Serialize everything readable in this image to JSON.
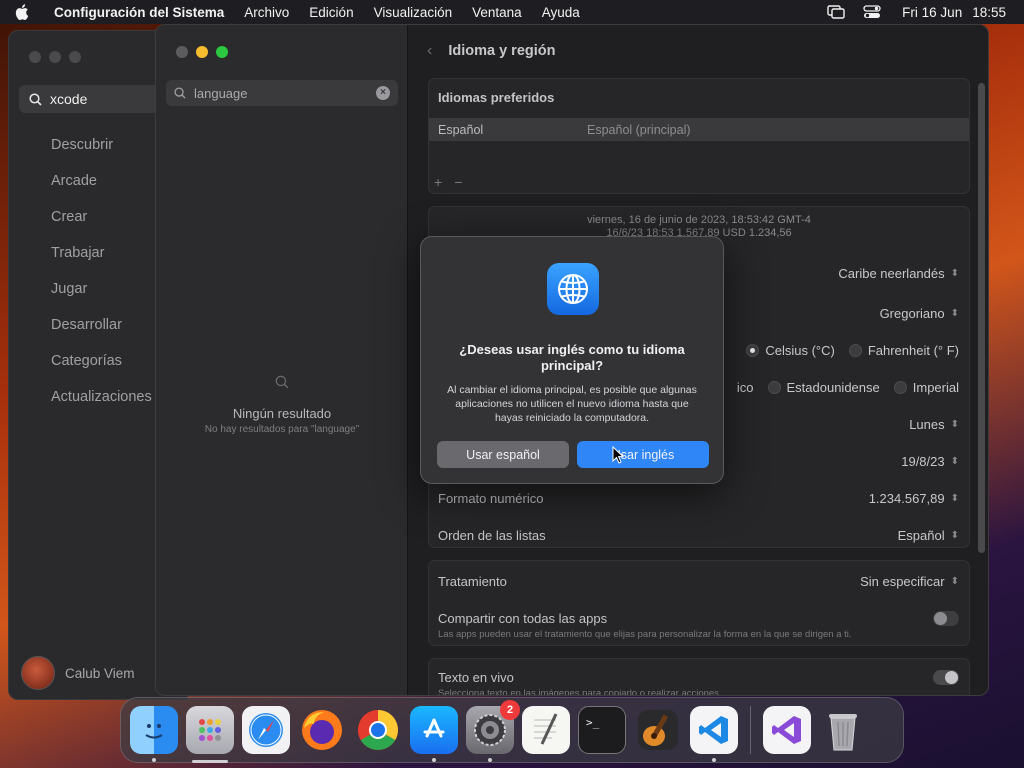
{
  "menubar": {
    "app_name": "Configuración del Sistema",
    "items": [
      "Archivo",
      "Edición",
      "Visualización",
      "Ventana",
      "Ayuda"
    ],
    "date": "Fri 16 Jun",
    "time": "18:55",
    "icons": [
      "apple-icon",
      "screen-mirroring-icon",
      "control-center-icon"
    ]
  },
  "appstore": {
    "search_value": "xcode",
    "nav": [
      "Descubrir",
      "Arcade",
      "Crear",
      "Trabajar",
      "Jugar",
      "Desarrollar",
      "Categorías",
      "Actualizaciones"
    ],
    "user_name": "Calub Viem"
  },
  "settings": {
    "search_value": "language",
    "empty_title": "Ningún resultado",
    "empty_subtitle": "No hay resultados para \"language\"",
    "page_title": "Idioma y región",
    "preferred": {
      "title": "Idiomas preferidos",
      "language": "Español",
      "language_note": "Español (principal)",
      "add": "+",
      "remove": "−"
    },
    "preview": {
      "line1": "viernes, 16 de junio de 2023, 18:53:42 GMT-4",
      "line2": "16/6/23 18:53       1.567,89       USD 1.234,56"
    },
    "rows": {
      "region": "Caribe neerlandés",
      "calendar": "Gregoriano",
      "temp_c": "Celsius (°C)",
      "temp_f": "Fahrenheit (° F)",
      "measure_partial": "ico",
      "measure_us": "Estadounidense",
      "measure_imperial": "Imperial",
      "first_day": "Lunes",
      "date_format": "19/8/23",
      "number_format_label": "Formato numérico",
      "number_format": "1.234.567,89",
      "list_order_label": "Orden de las listas",
      "list_order": "Español"
    },
    "address": {
      "label": "Tratamiento",
      "value": "Sin especificar",
      "share_label": "Compartir con todas las apps",
      "share_desc": "Las apps pueden usar el tratamiento que elijas para personalizar la forma en la que se dirigen a ti."
    },
    "live_text": {
      "label": "Texto en vivo",
      "desc": "Selecciona texto en las imágenes para copiarlo o realizar acciones."
    }
  },
  "dialog": {
    "title": "¿Deseas usar inglés como tu idioma principal?",
    "body": "Al cambiar el idioma principal, es posible que algunas aplicaciones no utilicen el nuevo idioma hasta que hayas reiniciado la computadora.",
    "secondary_label": "Usar español",
    "primary_label": "Usar inglés",
    "accent": "#2f86f6"
  },
  "dock": {
    "settings_badge": "2"
  }
}
